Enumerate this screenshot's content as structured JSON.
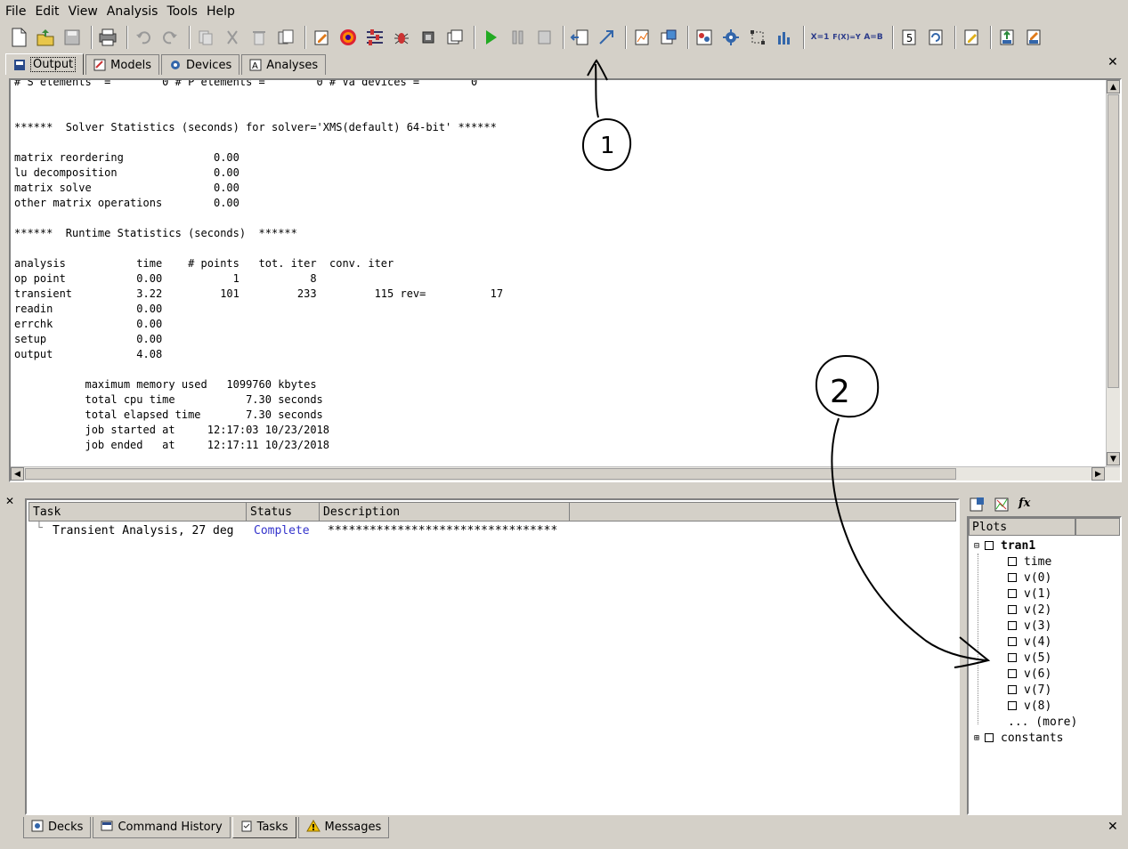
{
  "menu": {
    "file": "File",
    "edit": "Edit",
    "view": "View",
    "analysis": "Analysis",
    "tools": "Tools",
    "help": "Help"
  },
  "top_tabs": {
    "output": "Output",
    "models": "Models",
    "devices": "Devices",
    "analyses": "Analyses"
  },
  "output_lines": "# S elements  =        0 # P elements =        0 # Va devices =        0\n\n\n******  Solver Statistics (seconds) for solver='XMS(default) 64-bit' ******\n\nmatrix reordering              0.00\nlu decomposition               0.00\nmatrix solve                   0.00\nother matrix operations        0.00\n\n******  Runtime Statistics (seconds)  ******\n\nanalysis           time    # points   tot. iter  conv. iter\nop point           0.00           1           8\ntransient          3.22         101         233         115 rev=          17\nreadin             0.00\nerrchk             0.00\nsetup              0.00\noutput             4.08\n\n           maximum memory used   1099760 kbytes\n           total cpu time           7.30 seconds\n           total elapsed time       7.30 seconds\n           job started at     12:17:03 10/23/2018\n           job ended   at     12:17:11 10/23/2018",
  "tasks": {
    "headers": {
      "task": "Task",
      "status": "Status",
      "description": "Description"
    },
    "row": {
      "task": "Transient Analysis, 27 deg",
      "status": "Complete",
      "description": "*********************************"
    }
  },
  "plots": {
    "header": "Plots",
    "root": "tran1",
    "items": [
      "time",
      "v(0)",
      "v(1)",
      "v(2)",
      "v(3)",
      "v(4)",
      "v(5)",
      "v(6)",
      "v(7)",
      "v(8)"
    ],
    "more": "... (more)",
    "constants": "constants",
    "fx_label": "fx"
  },
  "bottom_tabs": {
    "decks": "Decks",
    "history": "Command History",
    "tasks": "Tasks",
    "messages": "Messages"
  },
  "toolbar_text": {
    "x1": "X=1",
    "fxy": "F(X)=Y",
    "ab": "A=B",
    "five": "5"
  },
  "annotations": {
    "one": "1",
    "two": "2"
  },
  "colors": {
    "status_complete": "#3333cc",
    "menu_bg": "#d4d0c8"
  }
}
